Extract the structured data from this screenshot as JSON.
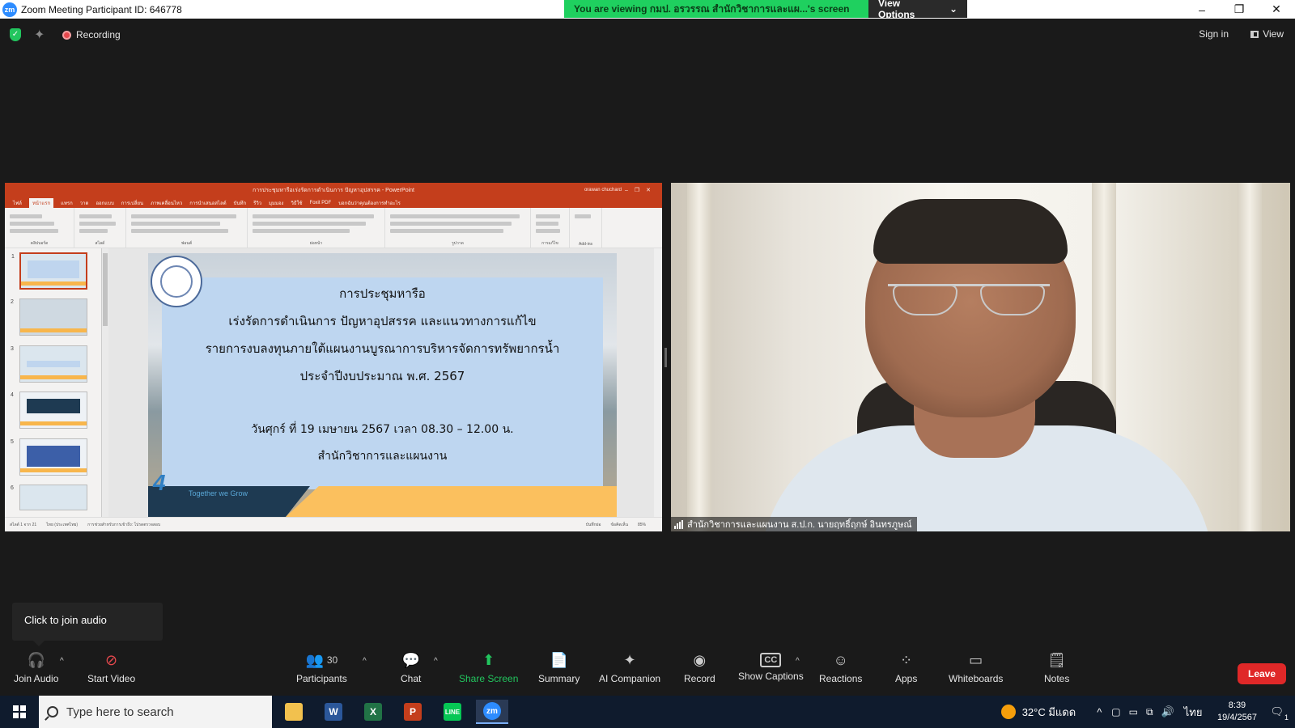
{
  "window": {
    "title": "Zoom Meeting Participant ID: 646778",
    "logo": "zm",
    "controls": [
      "–",
      "❐",
      "✕"
    ]
  },
  "banner": {
    "viewing_text": "You are viewing กมป. อรวรรณ สำนักวิชาการและแผ...'s screen",
    "view_options": "View Options"
  },
  "topbar": {
    "recording": "Recording",
    "sign_in": "Sign in",
    "view": "View"
  },
  "powerpoint": {
    "title": "การประชุมหารือเร่งรัดการดำเนินการ ปัญหาอุปสรรค - PowerPoint",
    "user": "orawan chuchard",
    "tabs": [
      "ไฟล์",
      "หน้าแรก",
      "แทรก",
      "วาด",
      "ออกแบบ",
      "การเปลี่ยน",
      "ภาพเคลื่อนไหว",
      "การนำเสนอสไลด์",
      "บันทึก",
      "รีวิว",
      "มุมมอง",
      "วิธีใช้",
      "Foxit PDF",
      "บอกฉันว่าคุณต้องการทำอะไร"
    ],
    "active_tab_index": 1,
    "ribbon_groups": [
      "คลิปบอร์ด",
      "สไลด์",
      "ฟอนต์",
      "ย่อหน้า",
      "รูปวาด",
      "การแก้ไข",
      "Add-ins"
    ],
    "thumbnail_numbers": [
      "1",
      "2",
      "3",
      "4",
      "5",
      "6"
    ],
    "status_left": "สไลด์ 1 จาก 21",
    "status_lang": "ไทย (ประเทศไทย)",
    "status_access": "การช่วยสำหรับการเข้าถึง: โปรดตรวจสอบ",
    "status_notes": "บันทึกย่อ",
    "status_comments": "ข้อคิดเห็น",
    "zoom_level": "85%"
  },
  "slide": {
    "line1": "การประชุมหารือ",
    "line2": "เร่งรัดการดำเนินการ ปัญหาอุปสรรค และแนวทางการแก้ไข",
    "line3": "รายการงบลงทุนภายใต้แผนงานบูรณาการบริหารจัดการทรัพยากรน้ำ",
    "line4": "ประจำปีงบประมาณ พ.ศ. 2567",
    "line5": "วันศุกร์ ที่ 19 เมษายน  2567  เวลา 08.30 – 12.00 น.",
    "line6": "สำนักวิชาการและแผนงาน",
    "tagline": "Together we Grow"
  },
  "video": {
    "participant_name": "สำนักวิชาการและแผนงาน ส.ป.ก. นายฤทธิ์ฤกษ์ อินทรภูษณ์"
  },
  "tooltip": {
    "text": "Click to join audio"
  },
  "toolbar": {
    "join_audio": "Join Audio",
    "start_video": "Start Video",
    "participants": "Participants",
    "participants_count": "30",
    "chat": "Chat",
    "share_screen": "Share Screen",
    "summary": "Summary",
    "ai_companion": "AI Companion",
    "record": "Record",
    "show_captions": "Show Captions",
    "reactions": "Reactions",
    "apps": "Apps",
    "whiteboards": "Whiteboards",
    "notes": "Notes",
    "leave": "Leave"
  },
  "taskbar": {
    "search_placeholder": "Type here to search",
    "weather": "32°C  มีแดด",
    "language": "ไทย",
    "time": "8:39",
    "date": "19/4/2567",
    "notification_count": "1",
    "apps": [
      "file-explorer",
      "word",
      "excel",
      "powerpoint",
      "line",
      "zoom"
    ]
  },
  "colors": {
    "banner_green": "#1fd05f",
    "leave_red": "#e02828",
    "share_green": "#22c55e",
    "powerpoint_red": "#c43e1c",
    "zoom_blue": "#2d8cff"
  }
}
